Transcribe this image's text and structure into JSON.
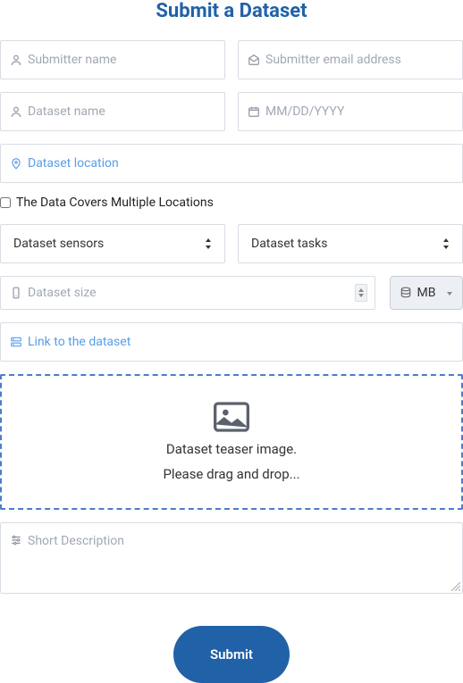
{
  "title": "Submit a Dataset",
  "fields": {
    "submitter_name_ph": "Submitter name",
    "submitter_email_ph": "Submitter email address",
    "dataset_name_ph": "Dataset name",
    "date_ph": "MM/DD/YYYY",
    "location_ph": "Dataset location",
    "multi_loc_label": "The Data Covers Multiple Locations",
    "sensors_label": "Dataset sensors",
    "tasks_label": "Dataset tasks",
    "size_ph": "Dataset size",
    "unit_label": "MB",
    "link_ph": "Link to the dataset",
    "teaser_line1": "Dataset teaser image.",
    "teaser_line2": "Please drag and drop...",
    "desc_ph": "Short Description",
    "submit_label": "Submit"
  }
}
